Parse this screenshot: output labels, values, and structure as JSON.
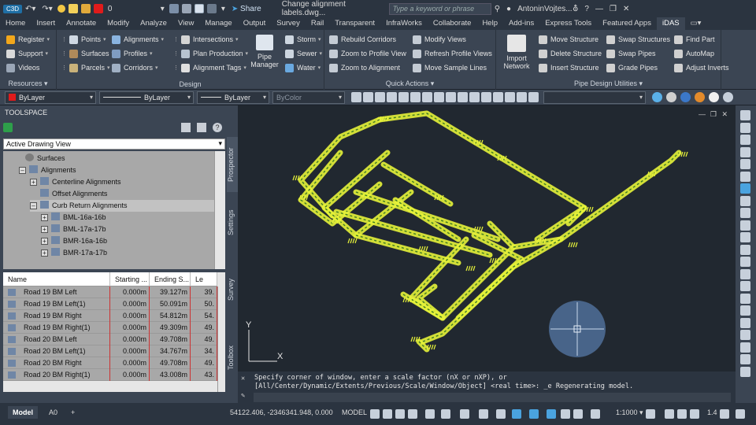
{
  "titlebar": {
    "app_badge": "C3D",
    "layer_value": "0",
    "share_label": "Share",
    "document_title": "Change alignment labels.dwg...",
    "search_placeholder": "Type a keyword or phrase",
    "user_name": "AntoninVojtes..."
  },
  "tabs": [
    "Home",
    "Insert",
    "Annotate",
    "Modify",
    "Analyze",
    "View",
    "Manage",
    "Output",
    "Survey",
    "Rail",
    "Transparent",
    "InfraWorks",
    "Collaborate",
    "Help",
    "Add-ins",
    "Express Tools",
    "Featured Apps",
    "iDAS"
  ],
  "active_tab": "iDAS",
  "ribbon": {
    "resources": {
      "title": "Resources",
      "items": [
        "Register",
        "Support",
        "Videos"
      ]
    },
    "design": {
      "title": "Design",
      "items": [
        "Points",
        "Surfaces",
        "Parcels",
        "Alignments",
        "Profiles",
        "Corridors",
        "Intersections",
        "Plan Production",
        "Alignment Tags",
        "Pipe Manager",
        "Storm",
        "Sewer",
        "Water"
      ]
    },
    "quick_actions": {
      "title": "Quick Actions",
      "items": [
        "Rebuild Corridors",
        "Zoom to Profile View",
        "Zoom to Alignment",
        "Modify Views",
        "Refresh Profile Views",
        "Move Sample Lines"
      ]
    },
    "pipe_utilities": {
      "title": "Pipe Design Utilities",
      "import_label": "Import Network",
      "items": [
        "Move Structure",
        "Delete Structure",
        "Insert Structure",
        "Swap Structures",
        "Swap Pipes",
        "Grade Pipes",
        "Find Part",
        "AutoMap",
        "Adjust Inverts"
      ]
    }
  },
  "propbar": {
    "color": "ByLayer",
    "linetype": "ByLayer",
    "lineweight": "ByLayer",
    "plotstyle": "ByColor"
  },
  "toolspace": {
    "title": "TOOLSPACE",
    "view_select": "Active Drawing View",
    "tree": [
      {
        "label": "Surfaces",
        "indent": 0
      },
      {
        "label": "Alignments",
        "indent": 0
      },
      {
        "label": "Centerline Alignments",
        "indent": 1
      },
      {
        "label": "Offset Alignments",
        "indent": 1
      },
      {
        "label": "Curb Return Alignments",
        "indent": 1
      },
      {
        "label": "BML-16a-16b",
        "indent": 2
      },
      {
        "label": "BML-17a-17b",
        "indent": 2
      },
      {
        "label": "BMR-16a-16b",
        "indent": 2
      },
      {
        "label": "BMR-17a-17b",
        "indent": 2
      }
    ],
    "columns": [
      "Name",
      "Starting ...",
      "Ending S...",
      "Le"
    ],
    "rows": [
      [
        "Road 19 BM Left",
        "0.000m",
        "39.127m",
        "39."
      ],
      [
        "Road 19 BM Left(1)",
        "0.000m",
        "50.091m",
        "50."
      ],
      [
        "Road 19 BM Right",
        "0.000m",
        "54.812m",
        "54."
      ],
      [
        "Road 19 BM Right(1)",
        "0.000m",
        "49.309m",
        "49."
      ],
      [
        "Road 20 BM Left",
        "0.000m",
        "49.708m",
        "49."
      ],
      [
        "Road 20 BM Left(1)",
        "0.000m",
        "34.767m",
        "34."
      ],
      [
        "Road 20 BM Right",
        "0.000m",
        "49.708m",
        "49."
      ],
      [
        "Road 20 BM Right(1)",
        "0.000m",
        "43.008m",
        "43."
      ]
    ],
    "side_tabs": [
      "Prospector",
      "Settings",
      "Survey",
      "Toolbox"
    ]
  },
  "command": {
    "line1": "Specify corner of window, enter a scale factor (nX or nXP), or",
    "line2": "[All/Center/Dynamic/Extents/Previous/Scale/Window/Object] <real time>: _e Regenerating model."
  },
  "status": {
    "tabs": [
      "Model",
      "A0"
    ],
    "coords": "54122.406, -2346341.948, 0.000",
    "model_label": "MODEL",
    "scale": "1:1000",
    "lineweight_value": "1.4"
  },
  "ucs": {
    "x_label": "X",
    "y_label": "Y"
  },
  "colors": {
    "network": "#e6f23a",
    "accent": "#f2a71b",
    "steering": "#4f6f99"
  }
}
